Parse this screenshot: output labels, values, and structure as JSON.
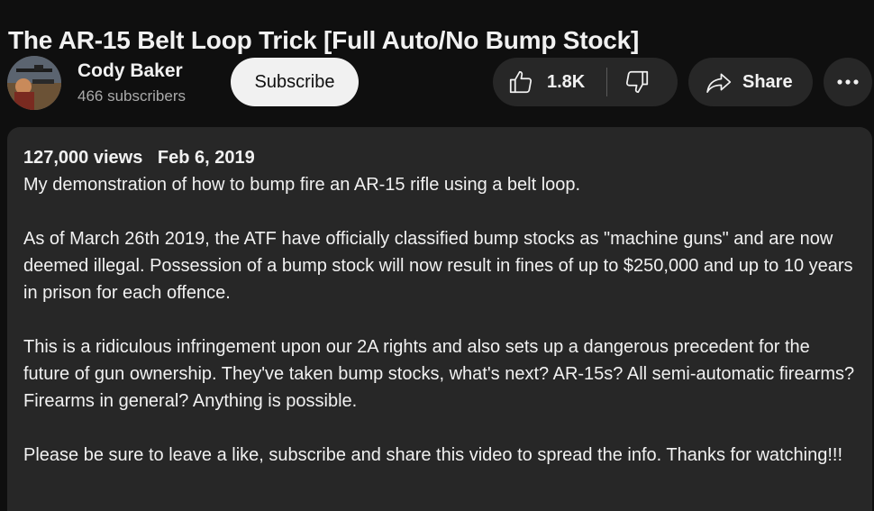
{
  "video": {
    "title": "The AR-15 Belt Loop Trick [Full Auto/No Bump Stock]"
  },
  "owner": {
    "channel_name": "Cody Baker",
    "subscriber_count": "466 subscribers",
    "subscribe_label": "Subscribe"
  },
  "actions": {
    "like_count": "1.8K",
    "like_icon": "thumbs-up-icon",
    "dislike_icon": "thumbs-down-icon",
    "share_label": "Share",
    "share_icon": "share-arrow-icon",
    "more_icon": "more-horizontal-icon"
  },
  "description": {
    "views": "127,000 views",
    "date": "Feb 6, 2019",
    "paragraphs": [
      "My demonstration of how to bump fire an AR-15 rifle using a belt loop.",
      "As of March 26th 2019, the ATF have officially classified bump stocks as \"machine guns\" and are now deemed illegal. Possession of a bump stock will now result in fines of up to $250,000 and up to 10 years in prison for each offence.",
      "This is a ridiculous infringement upon our 2A rights and also sets up a dangerous precedent for the future of gun ownership. They've taken bump stocks, what's next? AR-15s? All semi-automatic firearms? Firearms in general? Anything is possible.",
      "Please be sure to leave a like, subscribe and share this video to spread the info. Thanks for watching!!!"
    ]
  },
  "colors": {
    "background": "#0f0f0f",
    "surface": "#272727",
    "text_primary": "#f1f1f1",
    "text_secondary": "#aaaaaa"
  }
}
